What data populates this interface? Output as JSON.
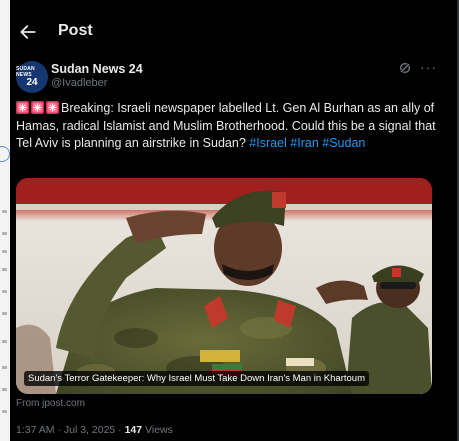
{
  "header": {
    "title": "Post"
  },
  "post": {
    "author": {
      "display_name": "Sudan News 24",
      "handle": "@Ivadleber",
      "avatar_text_top": "SUDAN NEWS",
      "avatar_text_bottom": "24"
    },
    "text_main": "Breaking: Israeli newspaper labelled Lt. Gen Al Burhan as an ally of Hamas, radical Islamist and Muslim Brotherhood. Could this be a signal that Tel Aviv is planning an airstrike in Sudan?",
    "hashtags": [
      "#Israel",
      "#Iran",
      "#Sudan"
    ],
    "media": {
      "caption": "Sudan's Terror Gatekeeper: Why Israel Must Take Down Iran's Man in Khartoum",
      "source": "From jpost.com"
    },
    "time": "1:37 AM",
    "date": "Jul 3, 2025",
    "separator": "·",
    "views_count": "147",
    "views_label": "Views"
  },
  "icons": {
    "back": "arrow-left-icon",
    "grok": "grok-icon",
    "more": "more-icon",
    "siren": "police-light-icon"
  },
  "colors": {
    "background": "#000000",
    "text": "#e7e9ea",
    "muted": "#71767b",
    "link": "#1d9bf0"
  }
}
